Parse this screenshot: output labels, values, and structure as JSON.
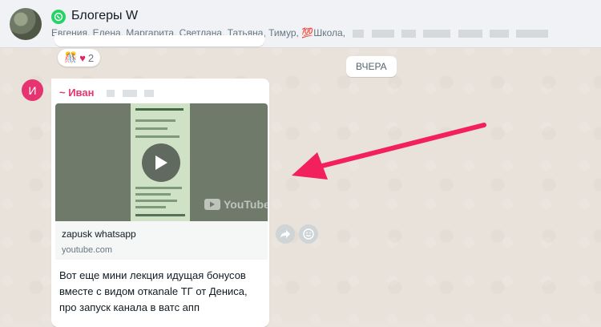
{
  "header": {
    "title": "Блогеры W",
    "members": "Евгения, Елена, Маргарита, Светлана, Татьяна, Тимур,",
    "members_emoji": "💯",
    "members_tail": "Школа,"
  },
  "previous_message": {
    "reactions": {
      "emoji1": "🎊",
      "emoji2": "♥",
      "count": "2"
    }
  },
  "date_divider": "ВЧЕРА",
  "message": {
    "avatar_letter": "И",
    "sender": "~ Иван",
    "link_preview": {
      "title": "zapusk whatsapp",
      "domain": "youtube.com",
      "watermark": "YouTube"
    },
    "text": "Вот еще мини лекция идущая бонусов вместе с видом откanale ТГ от Дениса, про запуск канала в ватс апп"
  },
  "colors": {
    "accent_pink": "#e5346f",
    "arrow": "#f2205c",
    "whatsapp_green": "#25d366"
  }
}
